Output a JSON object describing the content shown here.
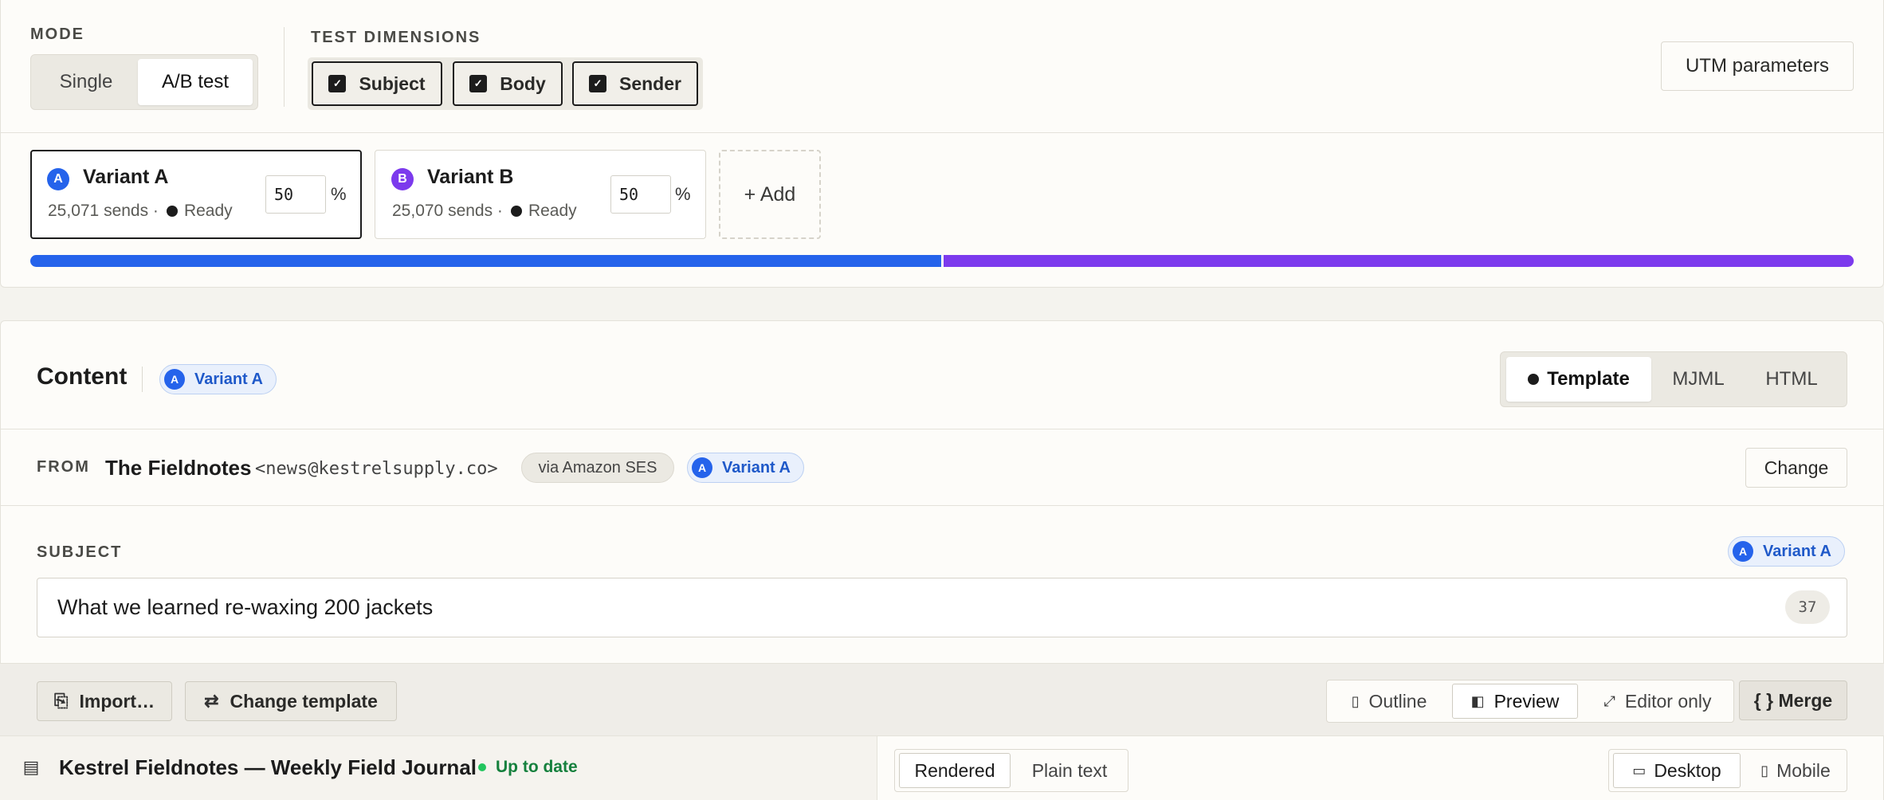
{
  "mode": {
    "label": "MODE",
    "options": [
      "Single",
      "A/B test"
    ]
  },
  "dimensions": {
    "label": "TEST DIMENSIONS",
    "items": [
      "Subject",
      "Body",
      "Sender"
    ]
  },
  "utm_button": "UTM parameters",
  "variants": [
    {
      "badge": "A",
      "name": "Variant A",
      "sends": "25,071 sends ·",
      "status": "Ready",
      "percent": "50",
      "color": "#2563eb",
      "share": 0.5
    },
    {
      "badge": "B",
      "name": "Variant B",
      "sends": "25,070 sends ·",
      "status": "Ready",
      "percent": "50",
      "color": "#7c3aed",
      "share": 0.5
    }
  ],
  "pct_symbol": "%",
  "add_label": "+ Add",
  "content": {
    "title": "Content",
    "variant_badge": "A",
    "variant_label": "Variant A",
    "tabs": [
      "Template",
      "MJML",
      "HTML"
    ]
  },
  "from": {
    "label": "FROM",
    "name": "The Fieldnotes",
    "email": "<news@kestrelsupply.co>",
    "via": "via Amazon SES",
    "variant_badge": "A",
    "variant_label": "Variant A",
    "change": "Change"
  },
  "subject": {
    "label": "SUBJECT",
    "variant_badge": "A",
    "variant_label": "Variant A",
    "value": "What we learned re-waxing 200 jackets",
    "count": "37"
  },
  "toolbar": {
    "import": "Import…",
    "change_template": "Change template",
    "views": [
      "Outline",
      "Preview",
      "Editor only"
    ],
    "merge": "{ } Merge"
  },
  "doc": {
    "title": "Kestrel Fieldnotes — Weekly Field Journal",
    "status": "Up to date",
    "render_modes": [
      "Rendered",
      "Plain text"
    ],
    "devices": [
      "Desktop",
      "Mobile"
    ]
  },
  "colors": {
    "accent_a": "#2563eb",
    "accent_b": "#7c3aed",
    "status_green": "#15803d"
  },
  "icons": [
    "check-icon",
    "import-icon",
    "swap-icon",
    "outline-icon",
    "preview-icon",
    "expand-icon",
    "document-icon",
    "desktop-icon",
    "mobile-icon"
  ]
}
